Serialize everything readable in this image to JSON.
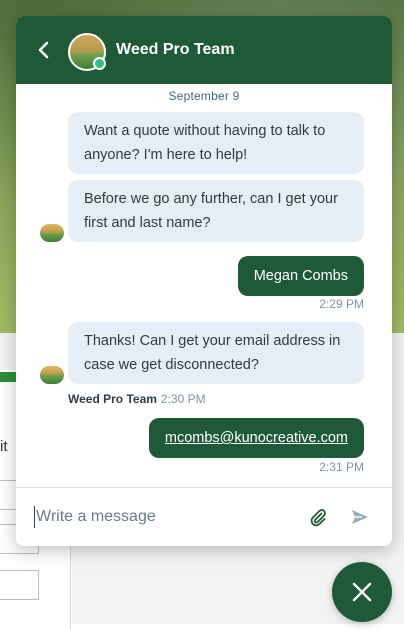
{
  "header": {
    "title": "Weed Pro Team",
    "back_icon": "chevron-left-icon",
    "status": "online"
  },
  "conversation": {
    "date_label": "September 9",
    "messages": [
      {
        "from": "agent",
        "text": "Want a quote without having to talk to anyone? I'm here to help!"
      },
      {
        "from": "agent",
        "text": "Before we go any further, can I get your first and last name?"
      },
      {
        "from": "visitor",
        "text": "Megan Combs",
        "time": "2:29 PM"
      },
      {
        "from": "agent",
        "text": "Thanks! Can I get your email address in case we get disconnected?",
        "sender": "Weed Pro Team",
        "time": "2:30 PM"
      },
      {
        "from": "visitor",
        "text": "mcombs@kunocreative.com",
        "time": "2:31 PM"
      }
    ]
  },
  "composer": {
    "placeholder": "Write a message",
    "attach_icon": "paperclip-icon",
    "send_icon": "send-icon"
  },
  "launcher": {
    "icon": "close-icon"
  },
  "background": {
    "form_fragment_text": "it"
  },
  "colors": {
    "brand": "#1f5a37",
    "agent_bubble": "#e6eef5",
    "timestamp": "#7d93a6"
  }
}
